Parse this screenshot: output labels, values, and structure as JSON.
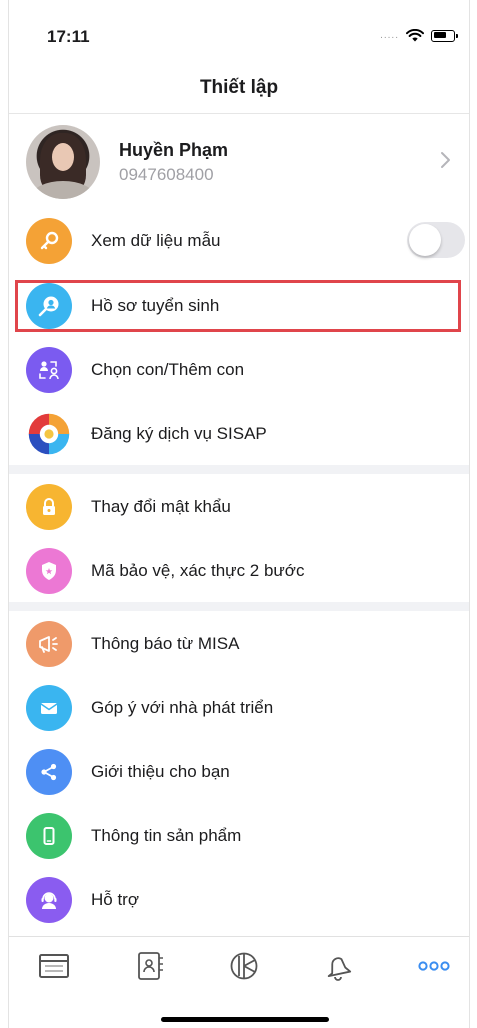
{
  "status_bar": {
    "time": "17:11",
    "signal": "....."
  },
  "header": {
    "title": "Thiết lập"
  },
  "profile": {
    "name": "Huyền Phạm",
    "phone": "0947608400"
  },
  "items": [
    {
      "label": "Xem dữ liệu mẫu",
      "icon": "key-icon",
      "color": "#f4a236",
      "toggle": false
    },
    {
      "label": "Hồ sơ tuyển sinh",
      "icon": "profile-search-icon",
      "color": "#3ab5f0",
      "highlighted": true
    },
    {
      "label": "Chọn con/Thêm con",
      "icon": "switch-users-icon",
      "color": "#7b5bf0"
    },
    {
      "label": "Đăng ký dịch vụ SISAP",
      "icon": "sisap-logo-icon"
    },
    {
      "label": "Thay đổi mật khẩu",
      "icon": "lock-icon",
      "color": "#f7b531"
    },
    {
      "label": "Mã bảo vệ, xác thực 2 bước",
      "icon": "shield-icon",
      "color": "#ec78d4"
    },
    {
      "label": "Thông báo từ MISA",
      "icon": "megaphone-icon",
      "color": "#ef9a6a"
    },
    {
      "label": "Góp ý với nhà phát triển",
      "icon": "mail-icon",
      "color": "#3ab5f0"
    },
    {
      "label": "Giới thiệu cho bạn",
      "icon": "share-icon",
      "color": "#4e8ff4"
    },
    {
      "label": "Thông tin sản phẩm",
      "icon": "phone-icon",
      "color": "#3cc46e"
    },
    {
      "label": "Hỗ trợ",
      "icon": "support-agent-icon",
      "color": "#8a5cf0"
    }
  ],
  "tabbar": {
    "tabs": [
      "browser-icon",
      "contacts-icon",
      "chart-icon",
      "bell-icon",
      "more-icon"
    ],
    "active_color": "#3a8df0"
  }
}
